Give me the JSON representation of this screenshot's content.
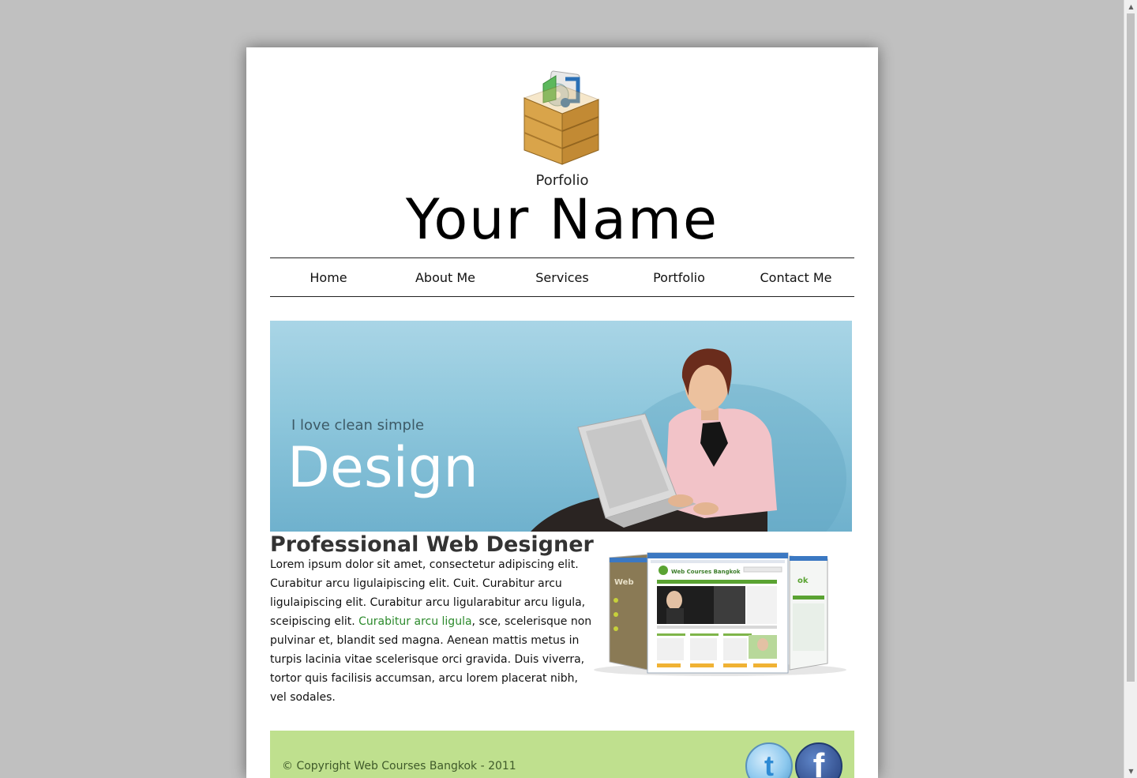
{
  "header": {
    "subtitle": "Porfolio",
    "name": "Your Name"
  },
  "nav": {
    "items": [
      {
        "label": "Home"
      },
      {
        "label": "About Me"
      },
      {
        "label": "Services"
      },
      {
        "label": "Portfolio"
      },
      {
        "label": "Contact Me"
      }
    ]
  },
  "hero": {
    "tagline": "I love clean simple",
    "title": "Design"
  },
  "main": {
    "title": "Professional Web Designer",
    "text_before_link": "Lorem ipsum dolor sit amet, consectetur adipiscing elit. Curabitur arcu ligulaipiscing elit. Cuit. Curabitur arcu ligulaipiscing elit. Curabitur arcu ligularabitur arcu ligula, sceipiscing elit. ",
    "link": "Curabitur arcu ligula",
    "text_after_link": ", sce, scelerisque non pulvinar et, blandit sed magna. Aenean mattis metus in turpis lacinia vitae scelerisque orci gravida. Duis viverra, tortor quis facilisis accumsan, arcu lorem placerat nibh, vel sodales.",
    "screenshot_brand": "Web Courses Bangkok"
  },
  "footer": {
    "copyright": "© Copyright Web Courses Bangkok - 2011",
    "twitter_glyph": "t",
    "facebook_glyph": "f"
  },
  "colors": {
    "page_bg": "#c0c0c0",
    "footer_bg": "#bfe08e",
    "link": "#2c8a2c",
    "hero_bg": "#8ec7dc"
  }
}
